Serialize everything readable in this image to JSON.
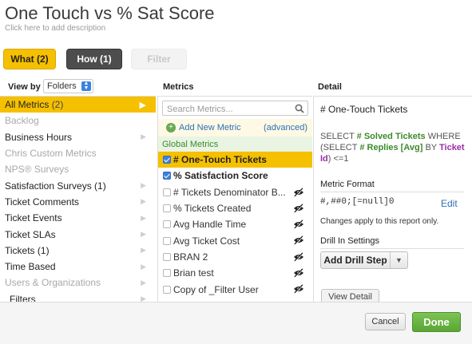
{
  "report": {
    "title": "One Touch vs % Sat Score",
    "description_placeholder": "Click here to add description"
  },
  "tabs": [
    {
      "label": "What (2)",
      "state": "active"
    },
    {
      "label": "How (1)",
      "state": "normal"
    },
    {
      "label": "Filter",
      "state": "disabled"
    }
  ],
  "view_by": {
    "label": "View by",
    "selected": "Folders"
  },
  "headers": {
    "metrics": "Metrics",
    "detail": "Detail"
  },
  "folders": [
    {
      "label": "All Metrics",
      "count": "(2)",
      "active": true,
      "arrow": true
    },
    {
      "label": "Backlog",
      "dim": true
    },
    {
      "label": "Business Hours",
      "arrow": true
    },
    {
      "label": "Chris Custom Metrics",
      "dim": true
    },
    {
      "label": "NPS® Surveys",
      "dim": true
    },
    {
      "label": "Satisfaction Surveys (1)",
      "arrow": true
    },
    {
      "label": "Ticket Comments",
      "arrow": true
    },
    {
      "label": "Ticket Events",
      "arrow": true
    },
    {
      "label": "Ticket SLAs",
      "arrow": true
    },
    {
      "label": "Tickets (1)",
      "arrow": true
    },
    {
      "label": "Time Based",
      "arrow": true
    },
    {
      "label": "Users & Organizations",
      "dim": true,
      "arrow": true
    },
    {
      "label": "Filters",
      "indent": true,
      "arrow": true
    }
  ],
  "metrics": {
    "search_placeholder": "Search Metrics...",
    "add_new": "Add New Metric",
    "advanced": "(advanced)",
    "group": "Global Metrics",
    "items": [
      {
        "label": "# One-Touch Tickets",
        "checked": true,
        "highlight": true
      },
      {
        "label": "% Satisfaction Score",
        "checked": true
      },
      {
        "label": "# Tickets Denominator B...",
        "hidden_icon": true
      },
      {
        "label": "% Tickets Created",
        "hidden_icon": true
      },
      {
        "label": "Avg Handle Time",
        "hidden_icon": true
      },
      {
        "label": "Avg Ticket Cost",
        "hidden_icon": true
      },
      {
        "label": "BRAN 2",
        "hidden_icon": true
      },
      {
        "label": "Brian test",
        "hidden_icon": true
      },
      {
        "label": "Copy of _Filter User",
        "hidden_icon": true
      }
    ]
  },
  "detail": {
    "metric_name": "# One-Touch Tickets",
    "sql": {
      "select_kw": "SELECT",
      "solved": "# Solved Tickets",
      "where_kw": "WHERE",
      "open": "(SELECT",
      "replies": "# Replies [Avg]",
      "by_kw": "BY",
      "ticket_id": "Ticket Id",
      "tail": ") <=1"
    },
    "format_heading": "Metric Format",
    "format_value": "#,##0;[=null]0",
    "edit": "Edit",
    "note": "Changes apply to this report only.",
    "drill_heading": "Drill In Settings",
    "drill_button": "Add Drill Step",
    "view_detail": "View Detail"
  },
  "footer": {
    "cancel": "Cancel",
    "done": "Done"
  },
  "colors": {
    "accent": "#f5c000",
    "done_green": "#5aa633",
    "link_blue": "#2e6fb7",
    "metric_green": "#3c8a2c",
    "attr_purple": "#9b2fa8"
  }
}
